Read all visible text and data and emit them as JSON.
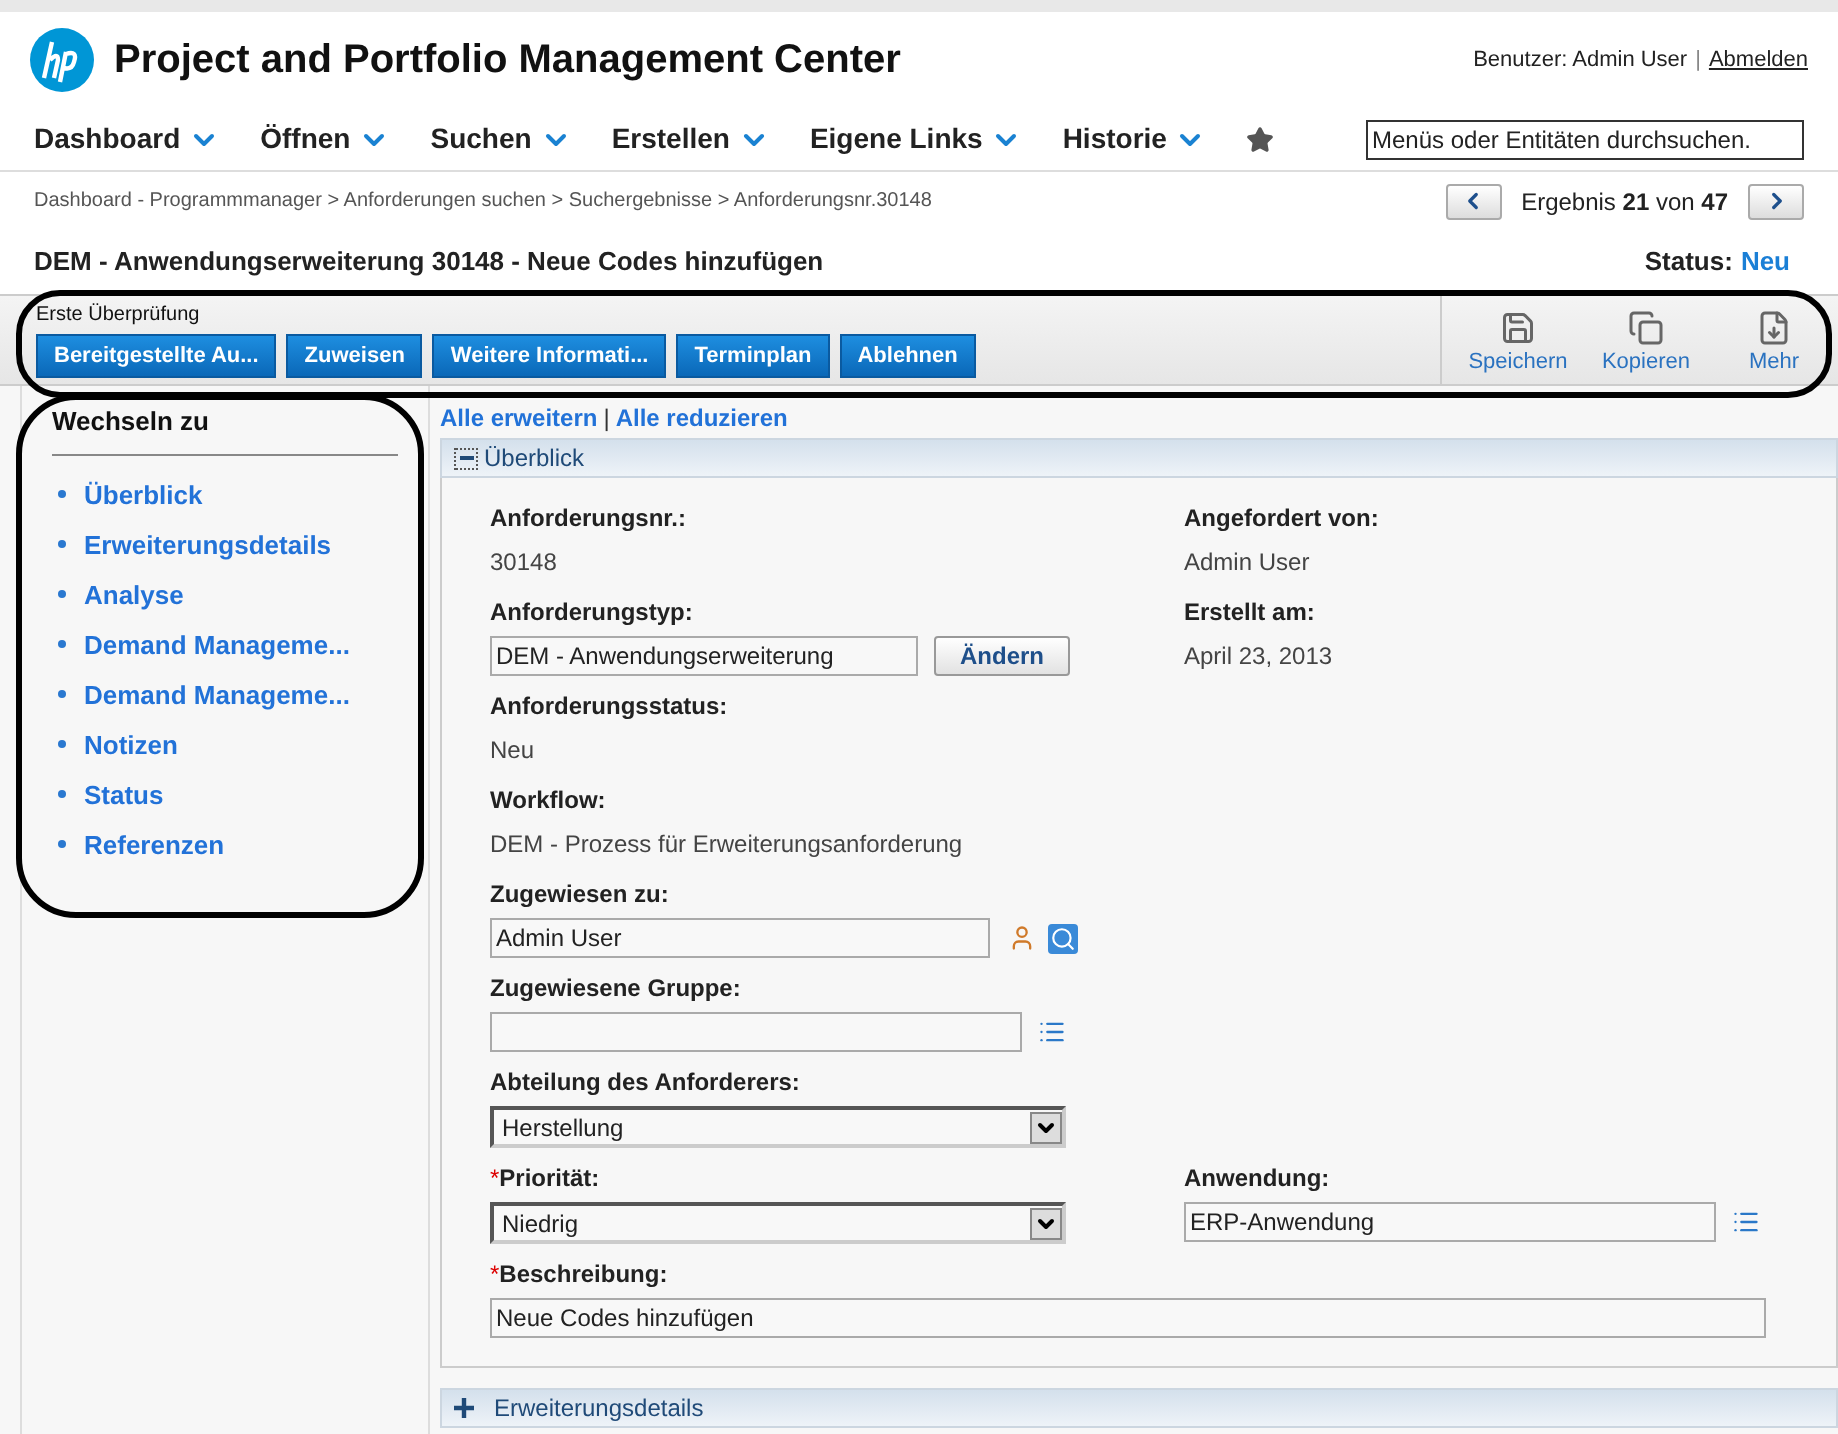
{
  "header": {
    "app_title": "Project and Portfolio Management Center",
    "user_label": "Benutzer: Admin User",
    "separator": "|",
    "logout": "Abmelden"
  },
  "nav": {
    "items": [
      "Dashboard",
      "Öffnen",
      "Suchen",
      "Erstellen",
      "Eigene Links",
      "Historie"
    ],
    "search": {
      "placeholder": "Menüs oder Entitäten durchsuchen."
    }
  },
  "breadcrumb": "Dashboard - Programmmanager > Anforderungen suchen > Suchergebnisse > Anforderungsnr.30148",
  "pager": {
    "text": "Ergebnis **21** von **47**"
  },
  "request_title": "DEM - Anwendungserweiterung 30148 - Neue Codes hinzufügen",
  "status": {
    "label": "Status:",
    "value": "Neu"
  },
  "toolbar": {
    "step": "Erste Überprüfung",
    "buttons": [
      "Bereitgestellte Au...",
      "Zuweisen",
      "Weitere Informati...",
      "Terminplan",
      "Ablehnen"
    ],
    "actions": [
      {
        "kind": "save",
        "label": "Speichern"
      },
      {
        "kind": "copy",
        "label": "Kopieren"
      },
      {
        "kind": "more",
        "label": "Mehr"
      }
    ]
  },
  "sidebar": {
    "title": "Wechseln zu",
    "items": [
      "Überblick",
      "Erweiterungsdetails",
      "Analyse",
      "Demand Manageme...",
      "Demand Manageme...",
      "Notizen",
      "Status",
      "Referenzen"
    ]
  },
  "expand_links": {
    "expand": "Alle erweitern",
    "separator": "|",
    "collapse": "Alle reduzieren"
  },
  "sections": [
    {
      "title": "Überblick",
      "expanded": true
    },
    {
      "title": "Erweiterungsdetails",
      "expanded": false
    }
  ],
  "form_rows": [
    {
      "left": {
        "kind": "text",
        "label": "Anforderungsnr.:",
        "value": "30148"
      },
      "right": {
        "kind": "text",
        "label": "Angefordert von:",
        "value": "Admin User"
      }
    },
    {
      "left": {
        "kind": "input_button",
        "label": "Anforderungstyp:",
        "value": "DEM - Anwendungserweiterung",
        "button": "Ändern"
      },
      "right": {
        "kind": "text",
        "label": "Erstellt am:",
        "value": "April 23, 2013"
      }
    },
    {
      "left": {
        "kind": "text",
        "label": "Anforderungsstatus:",
        "value": "Neu"
      }
    },
    {
      "left": {
        "kind": "text",
        "label": "Workflow:",
        "value": "DEM - Prozess für Erweiterungsanforderung"
      }
    },
    {
      "left": {
        "kind": "user_lookup",
        "label": "Zugewiesen zu:",
        "value": "Admin User"
      }
    },
    {
      "left": {
        "kind": "list_lookup",
        "label": "Zugewiesene Gruppe:"
      }
    },
    {
      "left": {
        "kind": "select",
        "label": "Abteilung des Anforderers:",
        "value": "Herstellung"
      }
    },
    {
      "left": {
        "kind": "select",
        "label": "Priorität:",
        "value": "Niedrig",
        "required_mark": "*"
      },
      "right": {
        "kind": "list_lookup",
        "label": "Anwendung:",
        "value": "ERP-Anwendung"
      }
    },
    {
      "left": {
        "kind": "wide_input",
        "label": "Beschreibung:",
        "value": "Neue Codes hinzufügen",
        "required_mark": "*"
      }
    }
  ]
}
